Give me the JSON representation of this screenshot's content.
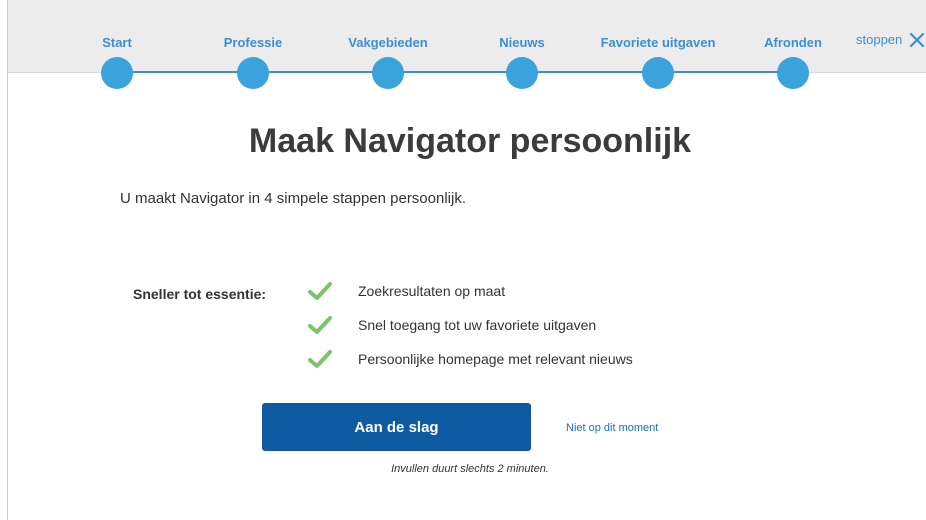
{
  "stepper": {
    "steps": [
      {
        "label": "Start"
      },
      {
        "label": "Professie"
      },
      {
        "label": "Vakgebieden"
      },
      {
        "label": "Nieuws"
      },
      {
        "label": "Favoriete uitgaven"
      },
      {
        "label": "Afronden"
      }
    ],
    "stop_label": "stoppen",
    "stop_icon": "close-icon",
    "accent_color": "#3aa3dc"
  },
  "main": {
    "title": "Maak Navigator persoonlijk",
    "subtitle": "U maakt Navigator in 4 simpele stappen persoonlijk.",
    "benefits_label": "Sneller tot essentie:",
    "benefits": [
      {
        "icon": "check-icon",
        "text": "Zoekresultaten op maat"
      },
      {
        "icon": "check-icon",
        "text": "Snel toegang tot uw favoriete uitgaven"
      },
      {
        "icon": "check-icon",
        "text": "Persoonlijke homepage met relevant nieuws"
      }
    ],
    "cta_label": "Aan de slag",
    "cta_color": "#0f5ba1",
    "later_label": "Niet op dit moment",
    "note": "Invullen duurt slechts 2 minuten.",
    "check_color": "#7cc36a"
  }
}
